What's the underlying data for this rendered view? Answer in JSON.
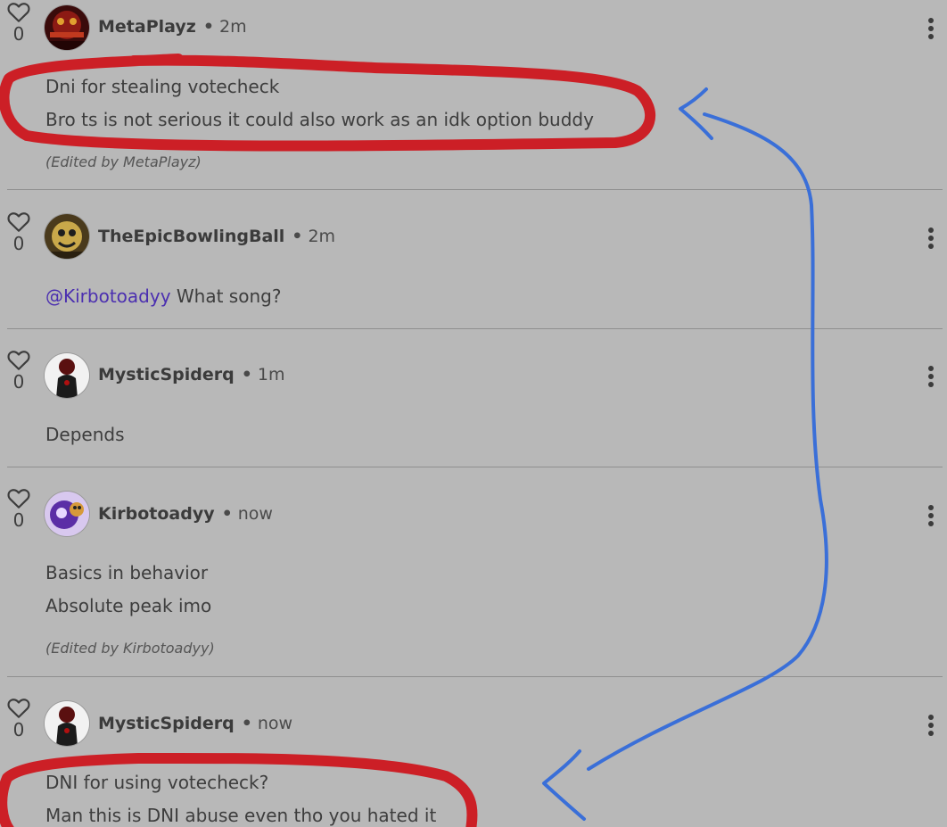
{
  "comments": [
    {
      "likes": "0",
      "author": "MetaPlayz",
      "separator": "•",
      "time": "2m",
      "lines": [
        "Dni for stealing votecheck",
        "Bro ts is not serious it could also work as an idk option buddy"
      ],
      "edited": "(Edited by MetaPlayz)"
    },
    {
      "likes": "0",
      "author": "TheEpicBowlingBall",
      "separator": "•",
      "time": "2m",
      "mention": "@Kirbotoadyy",
      "text": " What song?"
    },
    {
      "likes": "0",
      "author": "MysticSpiderq",
      "separator": "•",
      "time": "1m",
      "lines": [
        "Depends"
      ]
    },
    {
      "likes": "0",
      "author": "Kirbotoadyy",
      "separator": "•",
      "time": "now",
      "lines": [
        "Basics in behavior",
        "Absolute peak imo"
      ],
      "edited": "(Edited by Kirbotoadyy)"
    },
    {
      "likes": "0",
      "author": "MysticSpiderq",
      "separator": "•",
      "time": "now",
      "lines": [
        "DNI for using votecheck?",
        "Man this is DNI abuse even tho you hated it"
      ]
    }
  ],
  "colors": {
    "background": "#b8b8b8",
    "annotation_circle": "#cc1f26",
    "annotation_arrow": "#3a6fd8",
    "mention": "#4b2fb0"
  }
}
